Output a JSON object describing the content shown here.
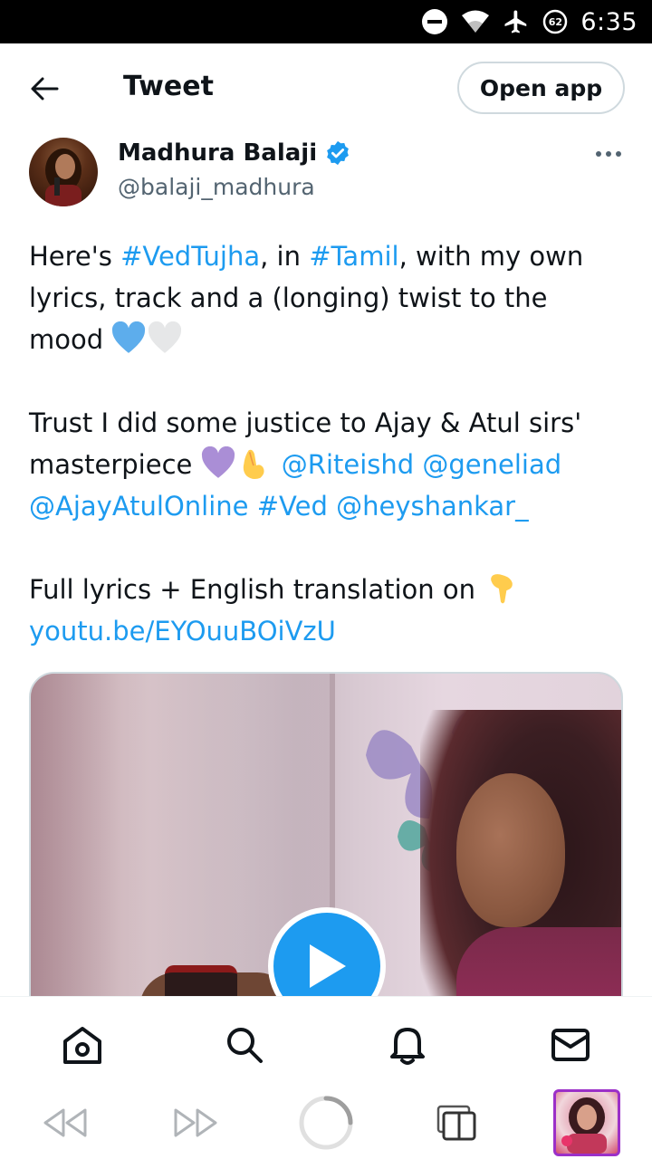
{
  "status_bar": {
    "time": "6:35",
    "battery_level": "62",
    "icons": [
      "do-not-disturb-icon",
      "wifi-icon",
      "airplane-mode-icon",
      "battery-icon"
    ]
  },
  "header": {
    "title": "Tweet",
    "open_app_label": "Open app"
  },
  "author": {
    "name": "Madhura Balaji",
    "handle": "@balaji_madhura",
    "verified": true
  },
  "tweet": {
    "p1_before": "Here's ",
    "p1_tag1": "#VedTujha",
    "p1_mid": ", in ",
    "p1_tag2": "#Tamil",
    "p1_after": ", with my own lyrics, track and a (longing) twist to the mood ",
    "p2_text": "Trust I did some justice to Ajay & Atul sirs' masterpiece ",
    "p2_mention1": "@Riteishd",
    "p2_mention2": "@geneliad",
    "p2_mention3": "@AjayAtulOnline",
    "p2_tag": "#Ved",
    "p2_mention4": "@heyshankar_",
    "p3_text": "Full lyrics + English translation on ",
    "p3_link": "youtu.be/EYOuuBOiVzU"
  },
  "bottom_nav": {
    "items": [
      "home-icon",
      "search-icon",
      "notifications-icon",
      "messages-icon"
    ]
  },
  "browser_bar": {
    "items": [
      "back-icon",
      "forward-icon",
      "loading-icon",
      "tabs-icon"
    ]
  },
  "colors": {
    "link": "#1d9bf0",
    "text": "#0f1419",
    "secondary": "#536471",
    "border": "#cfd9de",
    "tab_accent": "#9b30c8"
  }
}
